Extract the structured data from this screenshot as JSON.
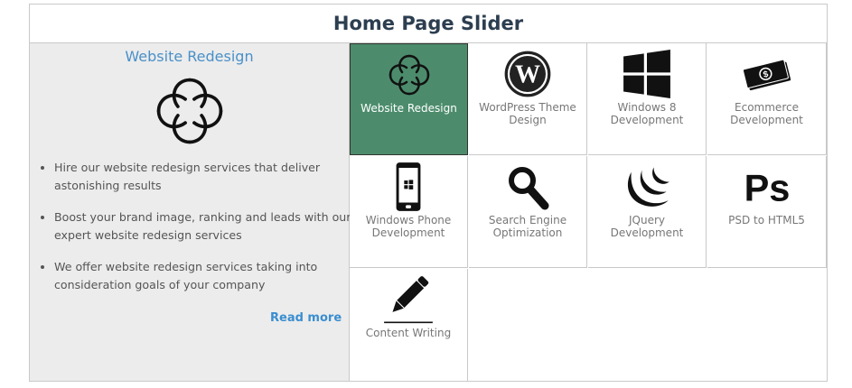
{
  "header": {
    "title": "Home Page Slider"
  },
  "detail": {
    "title": "Website Redesign",
    "icon": "swirl-logo-icon",
    "bullets": [
      "Hire our website redesign services that deliver astonishing results",
      "Boost your brand image, ranking and leads with our expert website redesign services",
      "We offer website redesign services taking into consideration goals of your company"
    ],
    "read_more": "Read more"
  },
  "tiles": [
    {
      "label": "Website Redesign",
      "icon": "swirl-logo-icon",
      "active": true
    },
    {
      "label": "WordPress Theme Design",
      "icon": "wordpress-icon",
      "active": false
    },
    {
      "label": "Windows 8 Development",
      "icon": "windows-icon",
      "active": false
    },
    {
      "label": "Ecommerce Development",
      "icon": "dollar-bill-icon",
      "active": false
    },
    {
      "label": "Windows Phone Development",
      "icon": "windows-phone-icon",
      "active": false
    },
    {
      "label": "Search Engine Optimization",
      "icon": "search-icon",
      "active": false
    },
    {
      "label": "JQuery Development",
      "icon": "jquery-icon",
      "active": false
    },
    {
      "label": "PSD to HTML5",
      "icon": "photoshop-icon",
      "active": false
    },
    {
      "label": "Content Writing",
      "icon": "pencil-icon",
      "active": false
    }
  ],
  "colors": {
    "active_tile": "#4c8c6c",
    "title": "#2c3e50",
    "link": "#3a8ed0",
    "detail_bg": "#ececec"
  }
}
